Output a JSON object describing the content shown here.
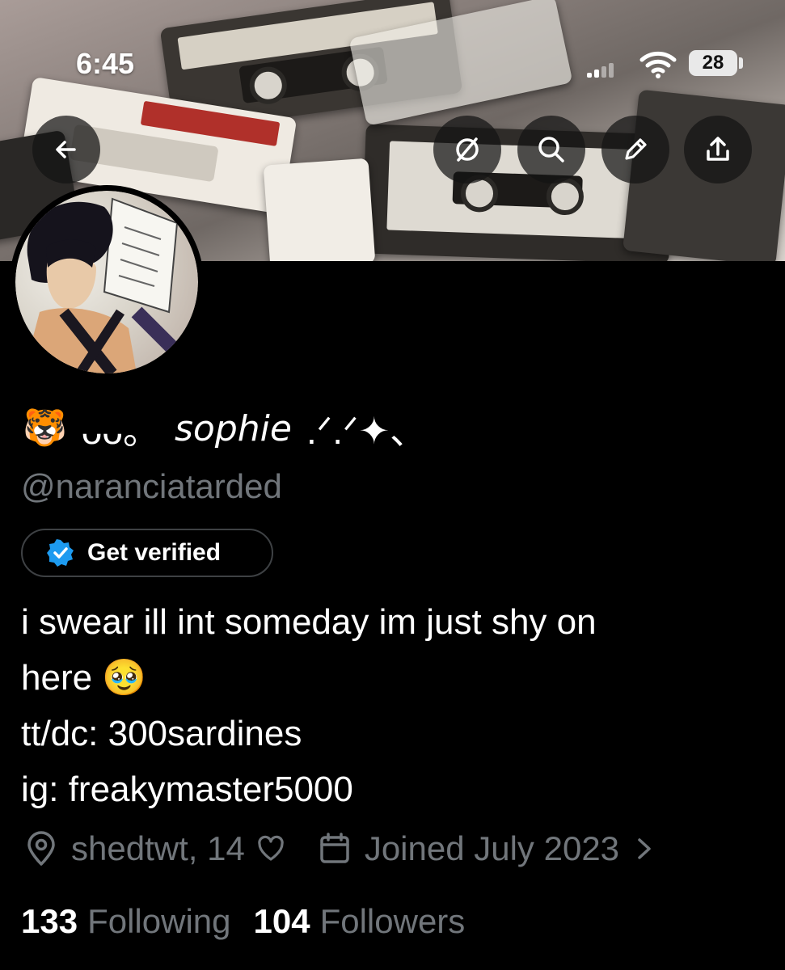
{
  "status_bar": {
    "time": "6:45",
    "battery": "28",
    "signal_icon": "cellular-signal-icon",
    "wifi_icon": "wifi-icon"
  },
  "header_actions": {
    "back_icon": "arrow-left-icon",
    "filter_icon": "slash-circle-icon",
    "search_icon": "search-icon",
    "edit_icon": "pencil-icon",
    "share_icon": "share-icon"
  },
  "profile": {
    "name_emoji": "🐯",
    "name_decor": "ᴗᴗ。",
    "display_name": "sophie",
    "name_suffix": ".ᐟ.ᐟ✦、",
    "handle": "@naranciatarded",
    "verify_label": "Get verified",
    "bio_lines": [
      "i swear ill int someday im just shy on",
      "here 🥹",
      "tt/dc: 300sardines",
      "ig: freakymaster5000"
    ],
    "location": "shedtwt, 14",
    "joined": "Joined July 2023",
    "following_count": "133",
    "following_label": "Following",
    "followers_count": "104",
    "followers_label": "Followers"
  },
  "colors": {
    "background": "#000000",
    "primary_text": "#ffffff",
    "secondary_text": "#71767b",
    "verified_blue": "#1d9bf0",
    "button_overlay": "rgba(20,20,20,0.72)"
  }
}
